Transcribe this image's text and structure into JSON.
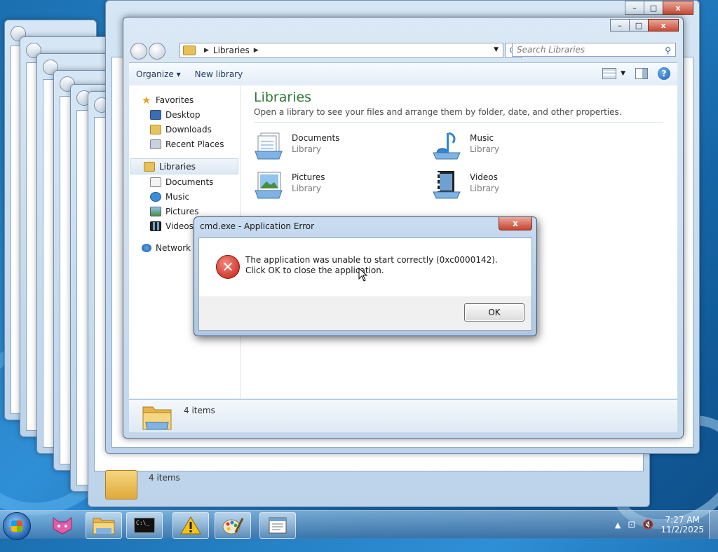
{
  "explorer": {
    "address_crumb": "Libraries",
    "search_placeholder": "Search Libraries",
    "toolbar": {
      "organize": "Organize",
      "new_library": "New library"
    },
    "nav": {
      "favorites": "Favorites",
      "favorites_items": [
        "Desktop",
        "Downloads",
        "Recent Places"
      ],
      "libraries": "Libraries",
      "libraries_items": [
        "Documents",
        "Music",
        "Pictures",
        "Videos"
      ],
      "network": "Network"
    },
    "content": {
      "title": "Libraries",
      "subtitle": "Open a library to see your files and arrange them by folder, date, and other properties.",
      "tiles": [
        {
          "name": "Documents",
          "type": "Library"
        },
        {
          "name": "Music",
          "type": "Library"
        },
        {
          "name": "Pictures",
          "type": "Library"
        },
        {
          "name": "Videos",
          "type": "Library"
        }
      ]
    },
    "details": "4 items"
  },
  "bg_details": "4 items",
  "dialog": {
    "title": "cmd.exe - Application Error",
    "close_label": "x",
    "message": "The application was unable to start correctly (0xc0000142). Click OK to close the application.",
    "ok_label": "OK"
  },
  "caption": {
    "minimize": "–",
    "maximize": "□",
    "close": "x"
  },
  "taskbar": {
    "apps": [
      "scratch-cat-icon",
      "explorer-icon",
      "cmd-icon",
      "warning-icon",
      "paint-icon",
      "notepad-icon"
    ],
    "cmd_glyph": "C:\\_",
    "clock_time": "7:27 AM",
    "clock_date": "11/2/2025"
  }
}
